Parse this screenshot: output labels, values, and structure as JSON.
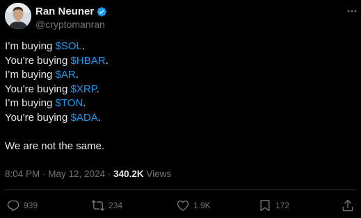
{
  "author": {
    "display_name": "Ran Neuner",
    "handle": "@cryptomanran",
    "verified_icon": "verified-badge-icon",
    "avatar": "avatar-photo"
  },
  "post": {
    "lines": [
      {
        "prefix": "I’m buying ",
        "tag": "$SOL",
        "suffix": "."
      },
      {
        "prefix": "You’re buying ",
        "tag": "$HBAR",
        "suffix": "."
      },
      {
        "prefix": "I’m buying ",
        "tag": "$AR",
        "suffix": "."
      },
      {
        "prefix": "You’re buying ",
        "tag": "$XRP",
        "suffix": "."
      },
      {
        "prefix": "I’m buying ",
        "tag": "$TON",
        "suffix": "."
      },
      {
        "prefix": "You’re buying ",
        "tag": "$ADA",
        "suffix": "."
      }
    ],
    "closing": "We are not the same."
  },
  "meta": {
    "time": "8:04 PM",
    "sep1": " · ",
    "date": "May 12, 2024",
    "sep2": " · ",
    "views_count": "340.2K",
    "views_label": " Views"
  },
  "actions": {
    "replies": "939",
    "reposts": "234",
    "likes": "1.9K",
    "bookmarks": "172"
  },
  "colors": {
    "background": "#000000",
    "text": "#e7e9ea",
    "muted": "#71767b",
    "accent": "#1d9bf0"
  }
}
